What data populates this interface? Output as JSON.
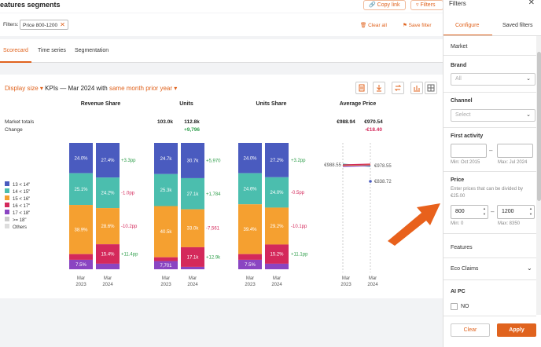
{
  "header": {
    "title": "eatures segments",
    "copy_link": "Copy link",
    "filters_btn": "Filters"
  },
  "filterbar": {
    "label": "Filters:",
    "chip": "Price 800-1200",
    "clear_all": "Clear all",
    "save_filter": "Save filter"
  },
  "tabs": [
    {
      "label": "Scorecard"
    },
    {
      "label": "Time series"
    },
    {
      "label": "Segmentation"
    }
  ],
  "selector": {
    "display_size": "Display size",
    "kpis": " KPIs — Mar 2024 with ",
    "same_month": "same month prior year"
  },
  "colors": {
    "accent": "#e0631e",
    "seg1": "#4a5bbf",
    "seg2": "#4bbeae",
    "seg3": "#f5a030",
    "seg4": "#d4295b",
    "seg5": "#8a45c2",
    "seg6": "#cccccc"
  },
  "chart_data": {
    "type": "bar",
    "stacked": true,
    "percent": true,
    "segments": [
      "13 < 14\"",
      "14 < 15\"",
      "15 < 16\"",
      "16 < 17\"",
      "17 < 18\"",
      ">= 18\"",
      "Others"
    ],
    "row_labels": {
      "market_totals": "Market totals",
      "change": "Change"
    },
    "panels": [
      {
        "title": "Revenue Share",
        "categories": [
          "Mar 2023",
          "Mar 2024"
        ],
        "totals": [
          "",
          ""
        ],
        "change": "",
        "series": [
          {
            "name": "13 < 14\"",
            "values": [
              24.0,
              27.4
            ],
            "change": "+3.3pp"
          },
          {
            "name": "14 < 15\"",
            "values": [
              25.1,
              24.2
            ],
            "change": "-1.0pp"
          },
          {
            "name": "15 < 16\"",
            "values": [
              38.9,
              28.6
            ],
            "change": "-10.2pp"
          },
          {
            "name": "16 < 17\"",
            "values": [
              4.5,
              15.4
            ],
            "change": "+11.4pp"
          },
          {
            "name": "17 < 18\"",
            "values": [
              7.5,
              4.4
            ],
            "change": ""
          }
        ],
        "labels": [
          [
            "24.0%",
            "25.1%",
            "38.9%",
            "",
            "7.5%"
          ],
          [
            "27.4%",
            "24.2%",
            "28.6%",
            "15.4%",
            ""
          ]
        ]
      },
      {
        "title": "Units",
        "categories": [
          "Mar 2023",
          "Mar 2024"
        ],
        "totals": [
          "103.0k",
          "112.8k"
        ],
        "change": "+9,796",
        "series": [
          {
            "name": "13 < 14\"",
            "values": [
              24.7,
              30.7
            ],
            "change": "+5,970"
          },
          {
            "name": "14 < 15\"",
            "values": [
              25.3,
              27.1
            ],
            "change": "+1,784"
          },
          {
            "name": "15 < 16\"",
            "values": [
              40.5,
              33.0
            ],
            "change": "-7,561"
          },
          {
            "name": "16 < 17\"",
            "values": [
              3.0,
              17.1
            ],
            "change": "+12.9k"
          },
          {
            "name": "17 < 18\"",
            "values": [
              6.5,
              2.1
            ],
            "change": ""
          }
        ],
        "labels": [
          [
            "24.7k",
            "25.3k",
            "40.5k",
            "",
            "7,701"
          ],
          [
            "30.7k",
            "27.1k",
            "33.0k",
            "17.1k",
            ""
          ]
        ]
      },
      {
        "title": "Units Share",
        "categories": [
          "Mar 2023",
          "Mar 2024"
        ],
        "totals": [
          "",
          ""
        ],
        "change": "",
        "series": [
          {
            "name": "13 < 14\"",
            "values": [
              24.0,
              27.2
            ],
            "change": "+3.2pp"
          },
          {
            "name": "14 < 15\"",
            "values": [
              24.6,
              24.0
            ],
            "change": "-0.5pp"
          },
          {
            "name": "15 < 16\"",
            "values": [
              39.4,
              29.2
            ],
            "change": "-10.1pp"
          },
          {
            "name": "16 < 17\"",
            "values": [
              4.5,
              15.2
            ],
            "change": "+11.1pp"
          },
          {
            "name": "17 < 18\"",
            "values": [
              7.5,
              4.4
            ],
            "change": ""
          }
        ],
        "labels": [
          [
            "24.0%",
            "24.6%",
            "39.4%",
            "",
            "7.5%"
          ],
          [
            "27.2%",
            "24.0%",
            "29.2%",
            "15.2%",
            ""
          ]
        ]
      },
      {
        "title": "Average Price",
        "type": "line",
        "categories": [
          "Mar 2023",
          "Mar 2024"
        ],
        "totals": [
          "€988.94",
          "€970.54"
        ],
        "change": "-€18.40",
        "start_label": "€988.55",
        "end_labels": [
          "€978.55",
          "€838.72"
        ]
      }
    ]
  },
  "panel": {
    "title": "Filters",
    "tabs": [
      "Configure",
      "Saved filters"
    ],
    "market": "Market",
    "brand": {
      "label": "Brand",
      "value": "All"
    },
    "channel": {
      "label": "Channel",
      "placeholder": "Select"
    },
    "first_activity": {
      "label": "First activity",
      "min": "Min: Oct 2015",
      "max": "Max: Jul 2024"
    },
    "price": {
      "label": "Price",
      "hint": "Enter prices that can be divided by €25.00",
      "min_value": "800",
      "max_value": "1200",
      "min": "Min: 0",
      "max": "Max: 8350"
    },
    "features": "Features",
    "eco_claims": "Eco Claims",
    "ai_pc": {
      "label": "AI PC",
      "option": "NO"
    },
    "clear": "Clear",
    "apply": "Apply"
  }
}
